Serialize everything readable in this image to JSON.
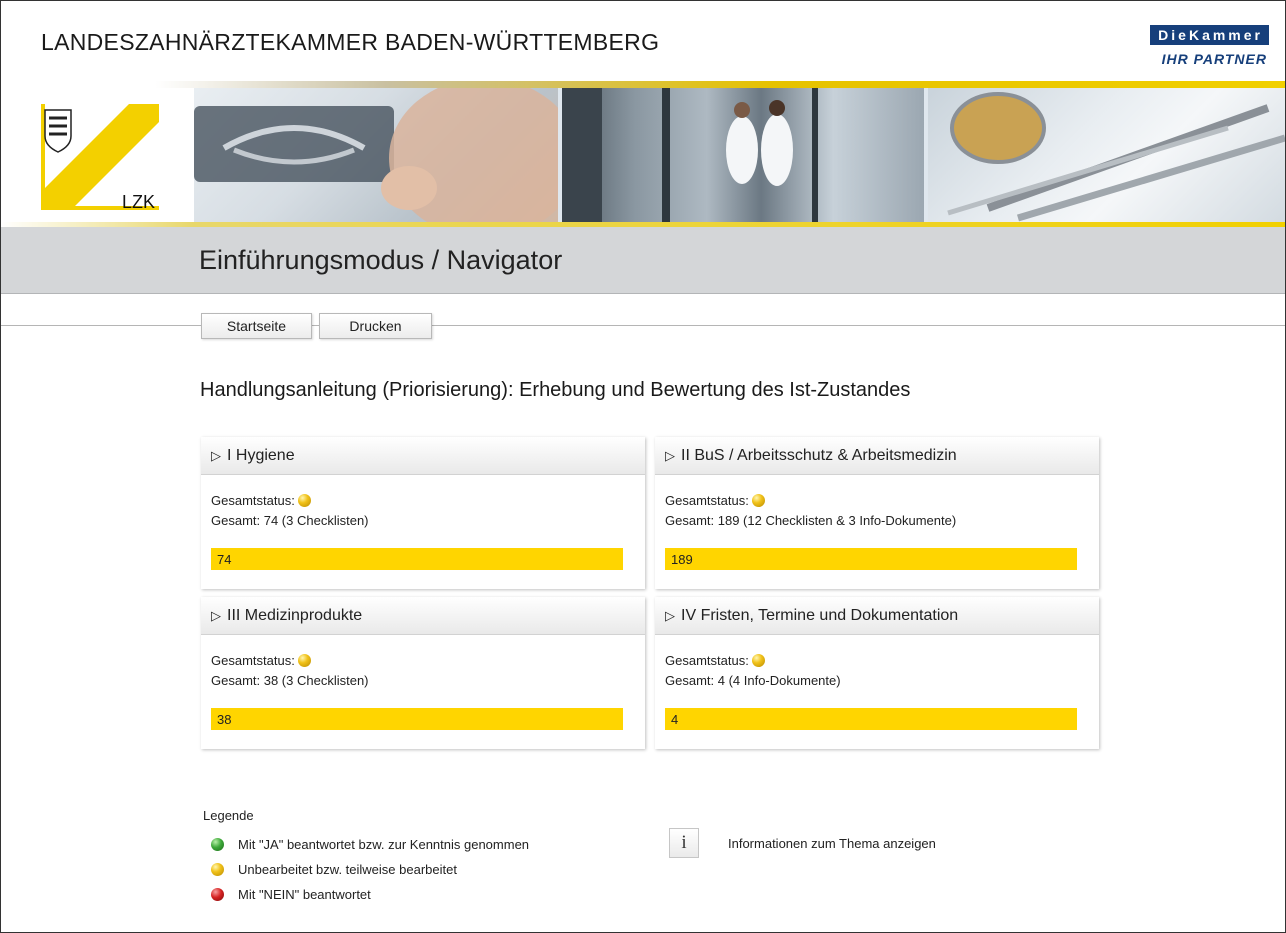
{
  "header": {
    "org_title": "LANDESZAHNÄRZTEKAMMER BADEN-WÜRTTEMBERG",
    "brand_top": "DieKammer",
    "brand_bottom": "IHR PARTNER"
  },
  "logo": {
    "label": "LZK"
  },
  "page": {
    "title": "Einführungsmodus / Navigator"
  },
  "nav": {
    "home": "Startseite",
    "print": "Drucken"
  },
  "main": {
    "heading": "Handlungsanleitung (Priorisierung): Erhebung und Bewertung des Ist-Zustandes",
    "status_label": "Gesamtstatus:",
    "panels": [
      {
        "title": "I Hygiene",
        "total": "Gesamt: 74 (3 Checklisten)",
        "value": "74",
        "progress_percent": 100
      },
      {
        "title": "II BuS / Arbeitsschutz & Arbeitsmedizin",
        "total": "Gesamt: 189 (12 Checklisten & 3 Info-Dokumente)",
        "value": "189",
        "progress_percent": 100
      },
      {
        "title": "III Medizinprodukte",
        "total": "Gesamt: 38 (3 Checklisten)",
        "value": "38",
        "progress_percent": 100
      },
      {
        "title": "IV Fristen, Termine und Dokumentation",
        "total": "Gesamt: 4 (4 Info-Dokumente)",
        "value": "4",
        "progress_percent": 100
      }
    ]
  },
  "legend": {
    "title": "Legende",
    "items": [
      {
        "label": "Mit \"JA\" beantwortet bzw. zur Kenntnis genommen",
        "color": "#3ea83a"
      },
      {
        "label": "Unbearbeitet bzw. teilweise bearbeitet",
        "color": "#f1c21a"
      },
      {
        "label": "Mit \"NEIN\" beantwortet",
        "color": "#d62222"
      }
    ],
    "info_icon": "i",
    "info_text": "Informationen zum Thema anzeigen"
  },
  "colors": {
    "accent": "#ffd500",
    "brand": "#163f7b"
  }
}
